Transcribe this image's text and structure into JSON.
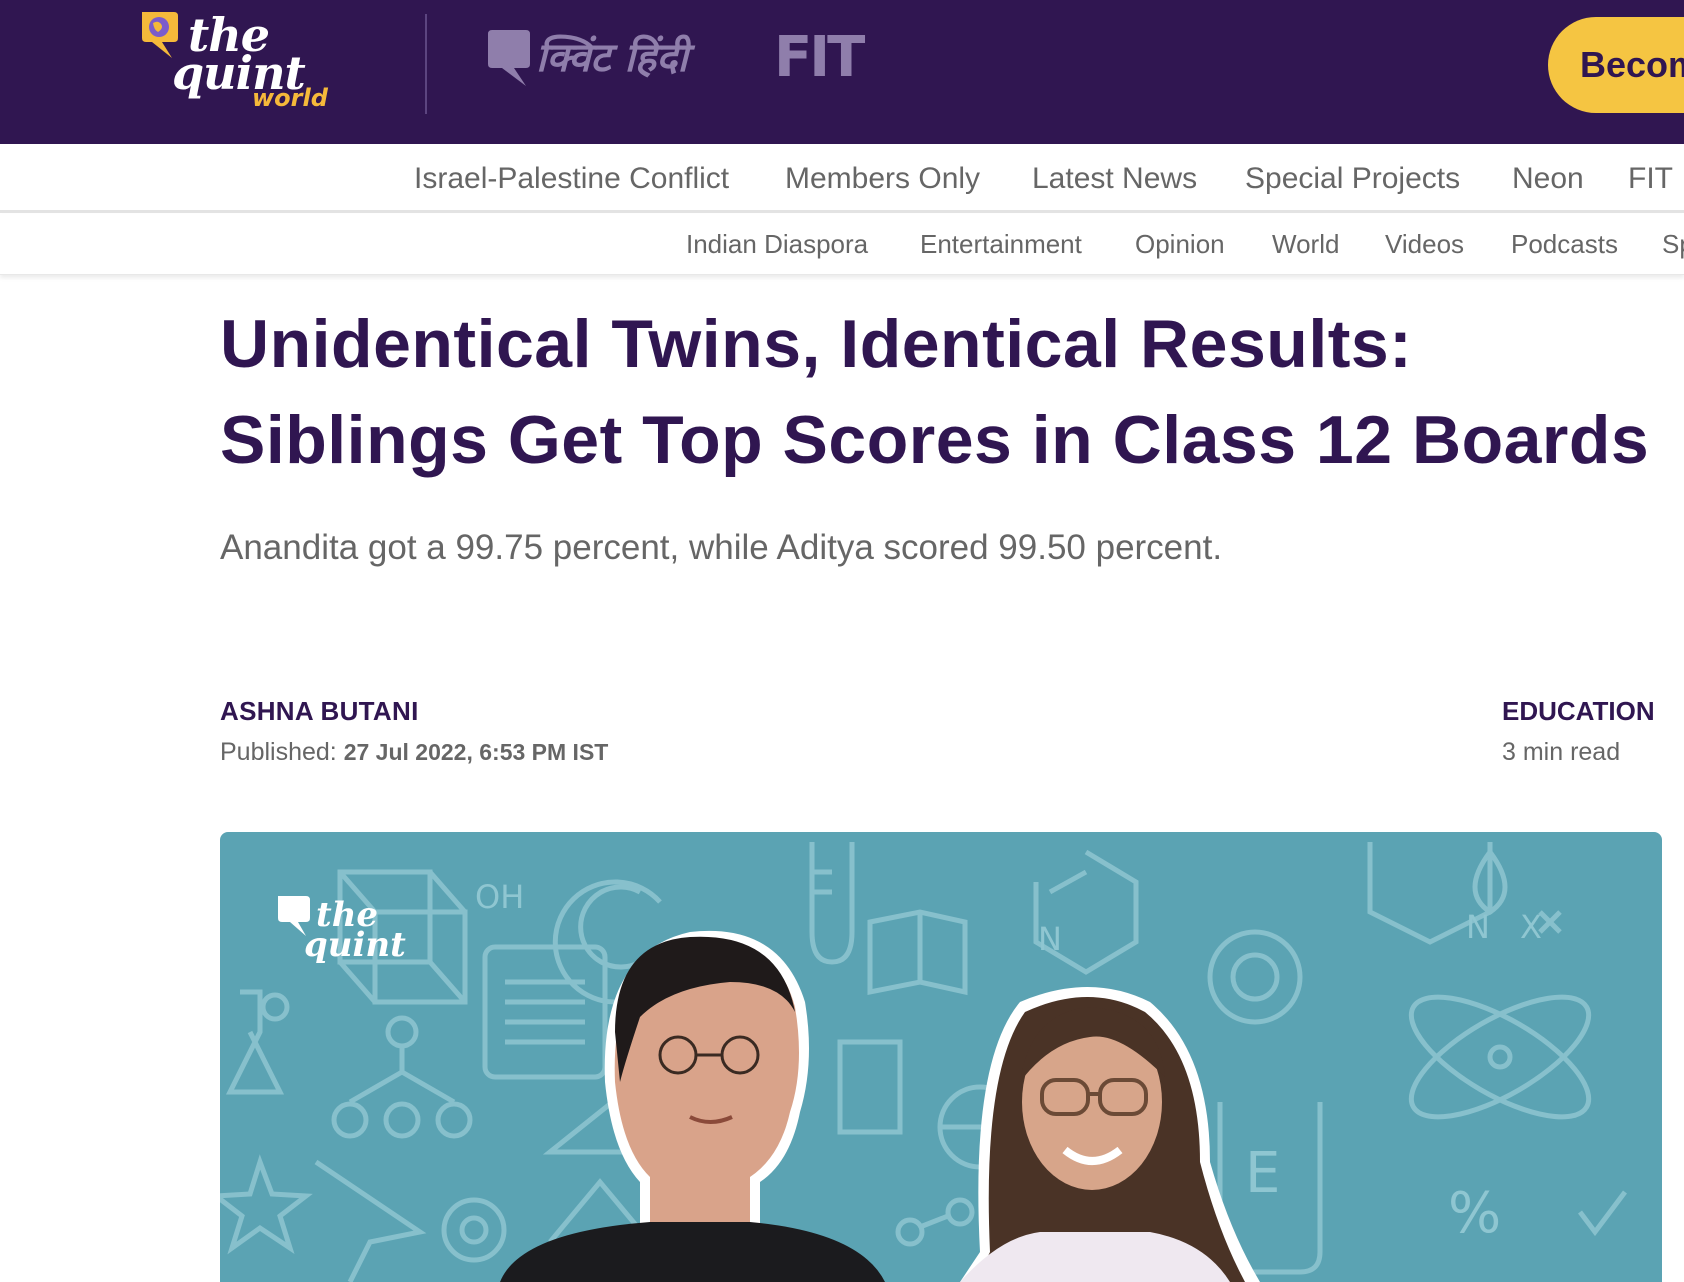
{
  "header": {
    "logo": {
      "line1": "the",
      "line2": "quint",
      "edition": "world"
    },
    "hindi_brand": "क्विंट हिंदी",
    "fit_brand": "FIT",
    "cta_label": "Becom",
    "brand_color": "#301651",
    "accent_color": "#f5c542"
  },
  "nav_primary": [
    {
      "label": "Israel-Palestine Conflict"
    },
    {
      "label": "Members Only"
    },
    {
      "label": "Latest News"
    },
    {
      "label": "Special Projects"
    },
    {
      "label": "Neon"
    },
    {
      "label": "FIT"
    }
  ],
  "nav_secondary": [
    {
      "label": "Indian Diaspora"
    },
    {
      "label": "Entertainment"
    },
    {
      "label": "Opinion"
    },
    {
      "label": "World"
    },
    {
      "label": "Videos"
    },
    {
      "label": "Podcasts"
    },
    {
      "label": "Sp"
    }
  ],
  "article": {
    "headline_line1": "Unidentical Twins, Identical Results:",
    "headline_line2": "Siblings Get Top Scores in Class 12 Boards",
    "subhead": "Anandita got a 99.75 percent, while Aditya scored 99.50 percent.",
    "author": "ASHNA BUTANI",
    "published_label": "Published:",
    "published_date": "27 Jul 2022, 6:53 PM IST",
    "category": "EDUCATION",
    "read_time": "3 min read"
  },
  "hero": {
    "logo": {
      "line1": "the",
      "line2": "quint"
    },
    "background_color": "#5ba3b3",
    "chem_labels": {
      "oh": "OH",
      "n1": "N",
      "n2": "N",
      "x": "X",
      "e": "E",
      "pct": "%"
    }
  }
}
